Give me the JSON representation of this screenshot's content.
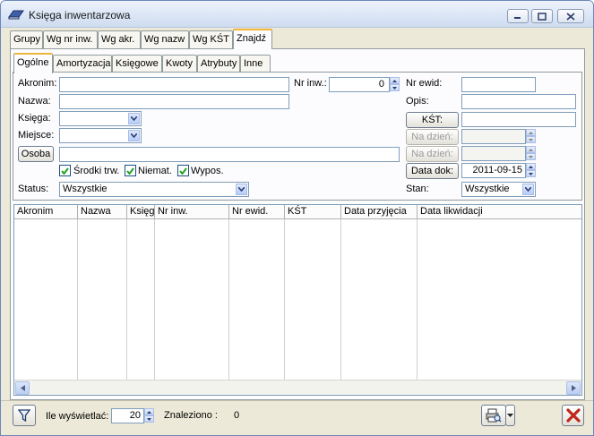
{
  "window": {
    "title": "Księga inwentarzowa"
  },
  "tabs_top": [
    "Grupy",
    "Wg nr inw.",
    "Wg akr.",
    "Wg nazw",
    "Wg KŚT",
    "Znajdź"
  ],
  "tabs_sub": [
    "Ogólne",
    "Amortyzacja",
    "Księgowe",
    "Kwoty",
    "Atrybuty",
    "Inne"
  ],
  "form": {
    "akronim_label": "Akronim:",
    "nazwa_label": "Nazwa:",
    "ksiega_label": "Księga:",
    "miejsce_label": "Miejsce:",
    "osoba_button": "Osoba",
    "nr_inw_label": "Nr inw.:",
    "nr_inw_value": "0",
    "nr_ewid_label": "Nr ewid:",
    "opis_label": "Opis:",
    "kst_button": "KŚT:",
    "na_dzien_1": "Na dzień:",
    "na_dzien_2": "Na dzień:",
    "data_dok_button": "Data dok:",
    "data_dok_value": "2011-09-15",
    "status_label": "Status:",
    "status_value": "Wszystkie",
    "stan_label": "Stan:",
    "stan_value": "Wszystkie",
    "checks": [
      {
        "label": "Środki trw.",
        "checked": true
      },
      {
        "label": "Niemat.",
        "checked": true
      },
      {
        "label": "Wypos.",
        "checked": true
      }
    ]
  },
  "grid": {
    "columns": [
      "Akronim",
      "Nazwa",
      "Księg",
      "Nr inw.",
      "Nr ewid.",
      "KŚT",
      "Data przyjęcia",
      "Data likwidacji"
    ]
  },
  "footer": {
    "ile_label": "Ile wyświetlać:",
    "ile_value": "20",
    "znaleziono_label": "Znaleziono :",
    "znaleziono_value": "0"
  },
  "colors": {
    "accent_tab": "#f0b43c",
    "close_red": "#c0261b",
    "border_blue": "#7f9db9"
  }
}
